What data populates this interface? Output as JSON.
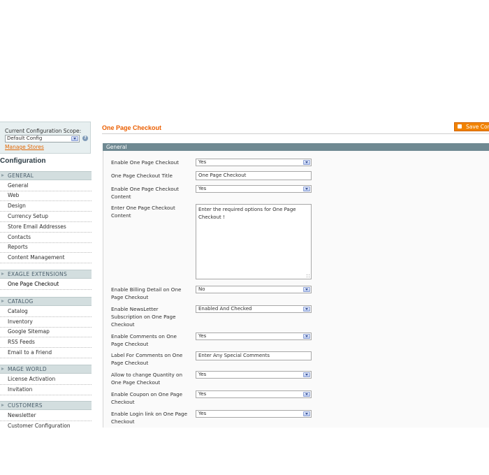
{
  "sidebar": {
    "scope_label": "Current Configuration Scope:",
    "scope_value": "Default Config",
    "manage_stores": "Manage Stores",
    "heading": "Configuration",
    "groups": [
      {
        "title": "GENERAL",
        "items": [
          "General",
          "Web",
          "Design",
          "Currency Setup",
          "Store Email Addresses",
          "Contacts",
          "Reports",
          "Content Management"
        ]
      },
      {
        "title": "EXAGLE EXTENSIONS",
        "items": [
          "One Page Checkout"
        ]
      },
      {
        "title": "CATALOG",
        "items": [
          "Catalog",
          "Inventory",
          "Google Sitemap",
          "RSS Feeds",
          "Email to a Friend"
        ]
      },
      {
        "title": "MAGE WORLD",
        "items": [
          "License Activation",
          "Invitation"
        ]
      },
      {
        "title": "CUSTOMERS",
        "items": [
          "Newsletter",
          "Customer Configuration"
        ]
      }
    ]
  },
  "main": {
    "title": "One Page Checkout",
    "save_button": "Save Config",
    "section_title": "General",
    "fields": [
      {
        "label": "Enable One Page Checkout",
        "type": "select",
        "value": "Yes"
      },
      {
        "label": "One Page Checkout Title",
        "type": "text",
        "value": "One Page Checkout"
      },
      {
        "label": "Enable One Page Checkout Content",
        "type": "select",
        "value": "Yes"
      },
      {
        "label": "Enter One Page Checkout Content",
        "type": "textarea",
        "value": "Enter the required options for One Page Checkout !"
      },
      {
        "label": "Enable Billing Detail on One Page Checkout",
        "type": "select",
        "value": "No"
      },
      {
        "label": "Enable NewsLetter Subscription on One Page Checkout",
        "type": "select",
        "value": "Enabled And Checked"
      },
      {
        "label": "Enable Comments on One Page Checkout",
        "type": "select",
        "value": "Yes"
      },
      {
        "label": "Label For Comments on One Page Checkout",
        "type": "text",
        "value": "Enter Any Special Comments"
      },
      {
        "label": "Allow to change Quantity on One Page Checkout",
        "type": "select",
        "value": "Yes"
      },
      {
        "label": "Enable Coupon on One Page Checkout",
        "type": "select",
        "value": "Yes"
      },
      {
        "label": "Enable Login link on One Page Checkout",
        "type": "select",
        "value": "Yes"
      }
    ]
  },
  "icons": {
    "help": "help-icon",
    "dropdown": "chevron-down-icon",
    "save": "save-icon",
    "group_arrow": "triangle-right-icon",
    "resize": "resize-grip-icon"
  }
}
